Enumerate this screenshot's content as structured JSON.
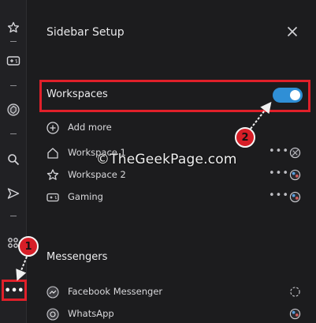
{
  "iconbar": {
    "items": [
      {
        "icon": "star-icon"
      },
      {
        "icon": "gamepad-icon"
      },
      {
        "icon": "chatgpt-icon"
      },
      {
        "icon": "search-icon"
      },
      {
        "icon": "send-icon"
      },
      {
        "icon": "apps-icon"
      },
      {
        "icon": "more-icon",
        "label": "•••"
      }
    ]
  },
  "panel": {
    "title": "Sidebar Setup",
    "workspaces": {
      "label": "Workspaces",
      "toggle_on": true,
      "add_more": "Add more",
      "items": [
        {
          "label": "Workspace 1",
          "icon": "home-icon"
        },
        {
          "label": "Workspace 2",
          "icon": "star-outline-icon"
        },
        {
          "label": "Gaming",
          "icon": "gamepad-icon"
        }
      ],
      "dots": "•••"
    },
    "messengers": {
      "label": "Messengers",
      "items": [
        {
          "label": "Facebook Messenger",
          "icon": "facebook-messenger-icon"
        },
        {
          "label": "WhatsApp",
          "icon": "whatsapp-icon"
        }
      ]
    }
  },
  "annotations": {
    "callout_1": "1",
    "callout_2": "2",
    "highlight_color": "#e0202a",
    "accent_color": "#2f8fd6"
  },
  "watermark": "©TheGeekPage.com"
}
